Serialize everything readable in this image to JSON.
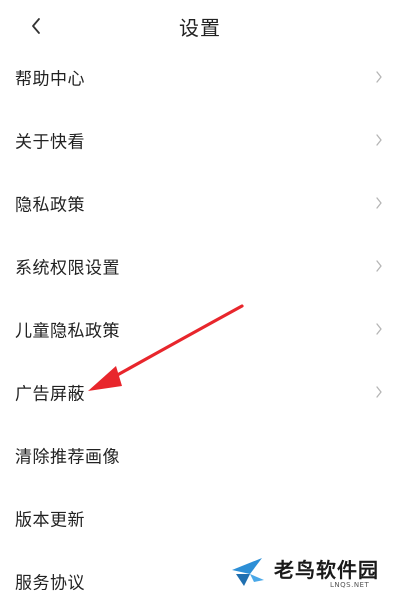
{
  "header": {
    "title": "设置",
    "back_icon": "chevron-left-icon"
  },
  "settings": {
    "items": [
      {
        "label": "帮助中心",
        "has_chevron": true
      },
      {
        "label": "关于快看",
        "has_chevron": true
      },
      {
        "label": "隐私政策",
        "has_chevron": true
      },
      {
        "label": "系统权限设置",
        "has_chevron": true
      },
      {
        "label": "儿童隐私政策",
        "has_chevron": true
      },
      {
        "label": "广告屏蔽",
        "has_chevron": true
      },
      {
        "label": "清除推荐画像",
        "has_chevron": false
      },
      {
        "label": "版本更新",
        "has_chevron": false
      },
      {
        "label": "服务协议",
        "has_chevron": false
      }
    ]
  },
  "annotation": {
    "arrow_color": "#e8262c",
    "points_to": "广告屏蔽"
  },
  "watermark": {
    "text": "老鸟软件园",
    "sub": "LNQS.NET",
    "logo_color": "#2d8fd6"
  }
}
